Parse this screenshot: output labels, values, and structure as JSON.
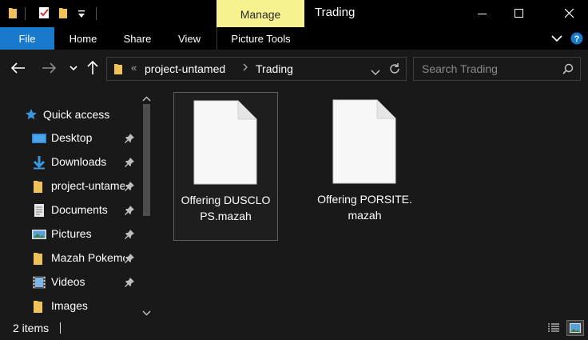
{
  "window": {
    "title": "Trading",
    "manage_label": "Manage"
  },
  "ribbon": {
    "tabs": [
      {
        "label": "File"
      },
      {
        "label": "Home"
      },
      {
        "label": "Share"
      },
      {
        "label": "View"
      },
      {
        "label": "Picture Tools"
      }
    ]
  },
  "address": {
    "overflow": "«",
    "crumbs": [
      "project-untamed",
      "Trading"
    ]
  },
  "search": {
    "placeholder": "Search Trading"
  },
  "nav": {
    "quick_access": "Quick access",
    "items": [
      {
        "label": "Desktop",
        "icon": "desktop-icon",
        "pinned": true
      },
      {
        "label": "Downloads",
        "icon": "downloads-icon",
        "pinned": true
      },
      {
        "label": "project-untamed",
        "icon": "folder-icon",
        "pinned": true
      },
      {
        "label": "Documents",
        "icon": "documents-icon",
        "pinned": true
      },
      {
        "label": "Pictures",
        "icon": "pictures-icon",
        "pinned": true
      },
      {
        "label": "Mazah Pokemon",
        "icon": "folder-icon",
        "pinned": true
      },
      {
        "label": "Videos",
        "icon": "videos-icon",
        "pinned": true
      },
      {
        "label": "Images",
        "icon": "folder-icon",
        "pinned": false
      }
    ]
  },
  "files": [
    {
      "name": "Offering DUSCLOPS.mazah",
      "selected": true
    },
    {
      "name": "Offering PORSITE.mazah",
      "selected": false
    }
  ],
  "status": {
    "count": "2 items"
  },
  "colors": {
    "accent": "#1979ca",
    "manage_tab": "#f5f28f",
    "folder": "#f0c35a"
  }
}
